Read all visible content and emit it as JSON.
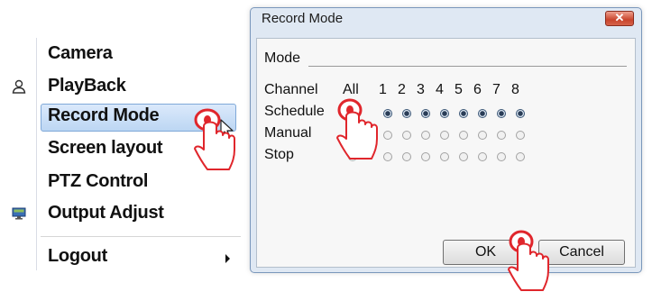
{
  "menu": {
    "items": [
      {
        "label": "Camera",
        "icon": ""
      },
      {
        "label": "PlayBack",
        "icon": "person-icon"
      },
      {
        "label": "Record Mode",
        "icon": "",
        "highlighted": true
      },
      {
        "label": "Screen layout",
        "icon": ""
      },
      {
        "label": "PTZ Control",
        "icon": ""
      },
      {
        "label": "Output Adjust",
        "icon": "monitor-icon"
      },
      {
        "label": "Logout",
        "icon": "",
        "submenu": true
      }
    ]
  },
  "dialog": {
    "title": "Record Mode",
    "close_label": "✕",
    "group_label": "Mode",
    "header": {
      "label": "Channel",
      "all": "All",
      "channels": [
        "1",
        "2",
        "3",
        "4",
        "5",
        "6",
        "7",
        "8"
      ]
    },
    "rows": [
      {
        "label": "Schedule",
        "state": "selected"
      },
      {
        "label": "Manual",
        "state": "unselected"
      },
      {
        "label": "Stop",
        "state": "unselected"
      }
    ],
    "ok_label": "OK",
    "cancel_label": "Cancel"
  },
  "colors": {
    "accent_red": "#e0262c",
    "highlight": "#c5dcf5",
    "dialog_frame": "#dfe8f3"
  }
}
